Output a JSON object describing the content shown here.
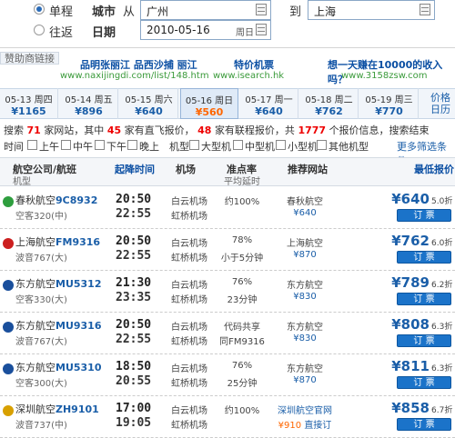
{
  "search": {
    "trip_oneway": "单程",
    "trip_return": "往返",
    "city_label": "城市",
    "from_label": "从",
    "from_value": "广州",
    "to_label": "到",
    "to_value": "上海",
    "date_label": "日期",
    "date_value": "2010-05-16",
    "weekday": "周日"
  },
  "ads": {
    "header": "赞助商链接",
    "items": [
      {
        "title": "品明张丽江 品西沙捕 丽江",
        "url": "www.naxijingdi.com/list/148.htm"
      },
      {
        "title": "特价机票",
        "url": "www.isearch.hk"
      },
      {
        "title": "想一天赚在10000的收入吗？",
        "url": "www.3158zsw.com"
      }
    ]
  },
  "date_tabs": [
    {
      "date": "05-13 周四",
      "price": "¥1165"
    },
    {
      "date": "05-14 周五",
      "price": "¥896"
    },
    {
      "date": "05-15 周六",
      "price": "¥640"
    },
    {
      "date": "05-16 周日",
      "price": "¥560",
      "selected": true
    },
    {
      "date": "05-17 周一",
      "price": "¥640"
    },
    {
      "date": "05-18 周二",
      "price": "¥762"
    },
    {
      "date": "05-19 周三",
      "price": "¥770"
    }
  ],
  "trend": {
    "line1": "价格",
    "line2": "日历"
  },
  "summary": {
    "p1": "搜索",
    "sites": "71",
    "p2": "家网站，其中",
    "direct": "45",
    "p3": "家有直飞报价，",
    "conn": "48",
    "p4": "家有联程报价，共",
    "quotes": "1777",
    "p5": "个报价信息，搜索结束"
  },
  "filters": {
    "time_label": "时间",
    "times": [
      "上午",
      "中午",
      "下午",
      "晚上"
    ],
    "type_label": "机型",
    "types": [
      "大型机",
      "中型机",
      "小型机",
      "其他机型"
    ],
    "more": "更多筛选条件"
  },
  "table_headers": {
    "airline": "航空公司/航班",
    "model": "机型",
    "depart": "起降时间",
    "airport": "机场",
    "ontime": "准点率",
    "delay": "平均延时",
    "site": "推荐网站",
    "price": "最低报价"
  },
  "flights": [
    {
      "airline": "春秋航空",
      "code": "9C8932",
      "plane": "空客320(中)",
      "dep": "20:50",
      "arr": "22:55",
      "ap1": "白云机场",
      "ap2": "虹桥机场",
      "rate": "约100%",
      "delay": "",
      "site": "春秋航空",
      "site_price": "¥640",
      "price": "¥640",
      "disc": "5.0折",
      "book": "订 票",
      "color": "#2e9e3e"
    },
    {
      "airline": "上海航空",
      "code": "FM9316",
      "plane": "波音767(大)",
      "dep": "20:50",
      "arr": "22:55",
      "ap1": "白云机场",
      "ap2": "虹桥机场",
      "rate": "78%",
      "delay": "小于5分钟",
      "site": "上海航空",
      "site_price": "¥870",
      "price": "¥762",
      "disc": "6.0折",
      "book": "订 票",
      "color": "#cc1f1f"
    },
    {
      "airline": "东方航空",
      "code": "MU5312",
      "plane": "空客330(大)",
      "dep": "21:30",
      "arr": "23:35",
      "ap1": "白云机场",
      "ap2": "虹桥机场",
      "rate": "76%",
      "delay": "23分钟",
      "site": "东方航空",
      "site_price": "¥830",
      "price": "¥789",
      "disc": "6.2折",
      "book": "订 票",
      "color": "#1a4f9c"
    },
    {
      "airline": "东方航空",
      "code": "MU9316",
      "plane": "波音767(大)",
      "dep": "20:50",
      "arr": "22:55",
      "ap1": "白云机场",
      "ap2": "虹桥机场",
      "rate": "代码共享",
      "delay": "同FM9316",
      "site": "东方航空",
      "site_price": "¥830",
      "price": "¥808",
      "disc": "6.3折",
      "book": "订 票",
      "color": "#1a4f9c"
    },
    {
      "airline": "东方航空",
      "code": "MU5310",
      "plane": "空客300(大)",
      "dep": "18:50",
      "arr": "20:55",
      "ap1": "白云机场",
      "ap2": "虹桥机场",
      "rate": "76%",
      "delay": "25分钟",
      "site": "东方航空",
      "site_price": "¥870",
      "price": "¥811",
      "disc": "6.3折",
      "book": "订 票",
      "color": "#1a4f9c"
    },
    {
      "airline": "深圳航空",
      "code": "ZH9101",
      "plane": "波音737(中)",
      "dep": "17:00",
      "arr": "19:05",
      "ap1": "白云机场",
      "ap2": "虹桥机场",
      "rate": "约100%",
      "delay": "",
      "site": "深圳航空官网",
      "site_price": "¥910",
      "site_extra": "直接订",
      "price": "¥858",
      "disc": "6.7折",
      "book": "订 票",
      "color": "#d8a000"
    }
  ]
}
